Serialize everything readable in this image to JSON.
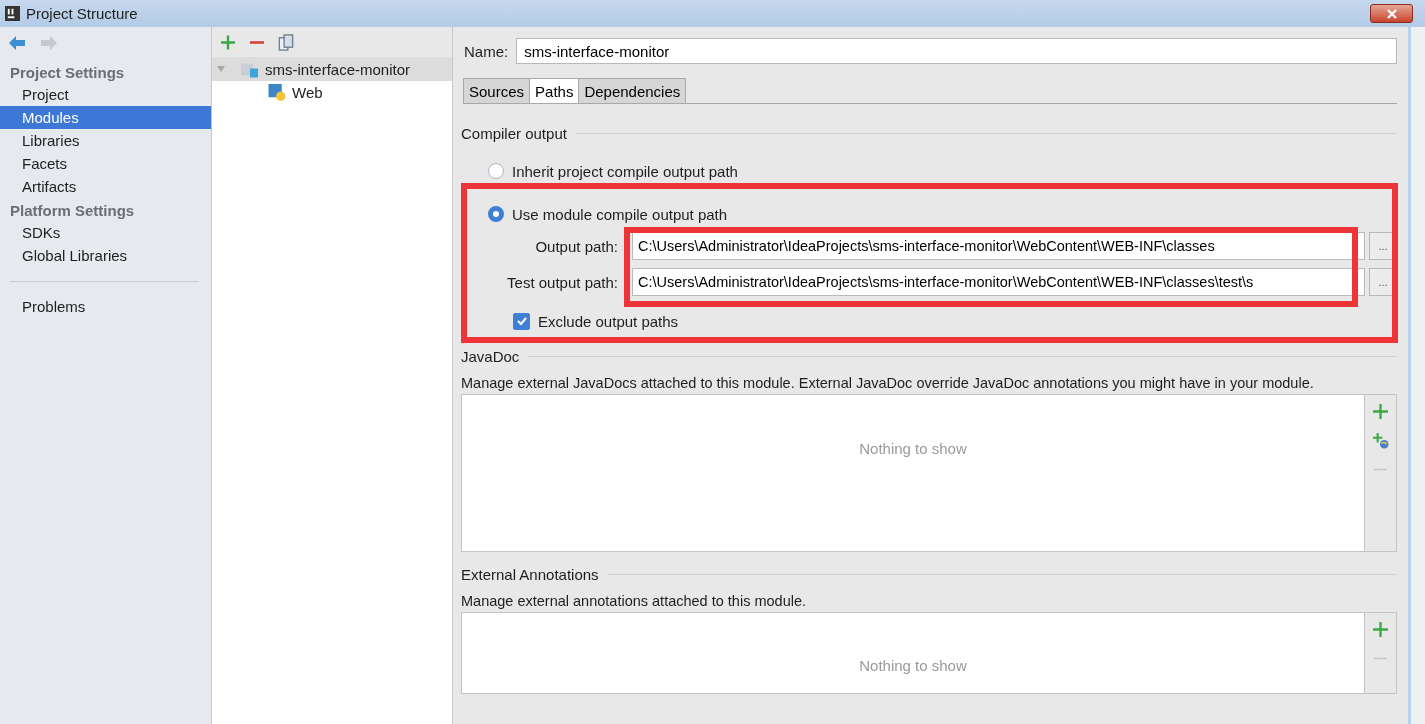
{
  "window": {
    "title": "Project Structure"
  },
  "sidebar": {
    "sections": [
      {
        "heading": "Project Settings",
        "items": [
          {
            "label": "Project",
            "selected": false
          },
          {
            "label": "Modules",
            "selected": true
          },
          {
            "label": "Libraries",
            "selected": false
          },
          {
            "label": "Facets",
            "selected": false
          },
          {
            "label": "Artifacts",
            "selected": false
          }
        ]
      },
      {
        "heading": "Platform Settings",
        "items": [
          {
            "label": "SDKs",
            "selected": false
          },
          {
            "label": "Global Libraries",
            "selected": false
          }
        ]
      }
    ],
    "extra_items": [
      {
        "label": "Problems",
        "selected": false
      }
    ]
  },
  "module_tree": {
    "items": [
      {
        "label": "sms-interface-monitor",
        "expanded": true,
        "selected": true,
        "children": [
          {
            "label": "Web",
            "selected": false
          }
        ]
      }
    ]
  },
  "name_field": {
    "label": "Name:",
    "value": "sms-interface-monitor"
  },
  "tabs": [
    {
      "label": "Sources",
      "selected": false
    },
    {
      "label": "Paths",
      "selected": true
    },
    {
      "label": "Dependencies",
      "selected": false
    }
  ],
  "compiler_output": {
    "title": "Compiler output",
    "options": [
      {
        "label": "Inherit project compile output path",
        "selected": false
      },
      {
        "label": "Use module compile output path",
        "selected": true
      }
    ],
    "paths": [
      {
        "label": "Output path:",
        "value": "C:\\Users\\Administrator\\IdeaProjects\\sms-interface-monitor\\WebContent\\WEB-INF\\classes",
        "browse": "..."
      },
      {
        "label": "Test output path:",
        "value": "C:\\Users\\Administrator\\IdeaProjects\\sms-interface-monitor\\WebContent\\WEB-INF\\classes\\test\\s",
        "browse": "..."
      }
    ],
    "exclude": {
      "label": "Exclude output paths",
      "checked": true
    }
  },
  "javadoc": {
    "title": "JavaDoc",
    "description": "Manage external JavaDocs attached to this module. External JavaDoc override JavaDoc annotations you might have in your module.",
    "empty_text": "Nothing to show"
  },
  "external_annotations": {
    "title": "External Annotations",
    "description": "Manage external annotations attached to this module.",
    "empty_text": "Nothing to show"
  }
}
